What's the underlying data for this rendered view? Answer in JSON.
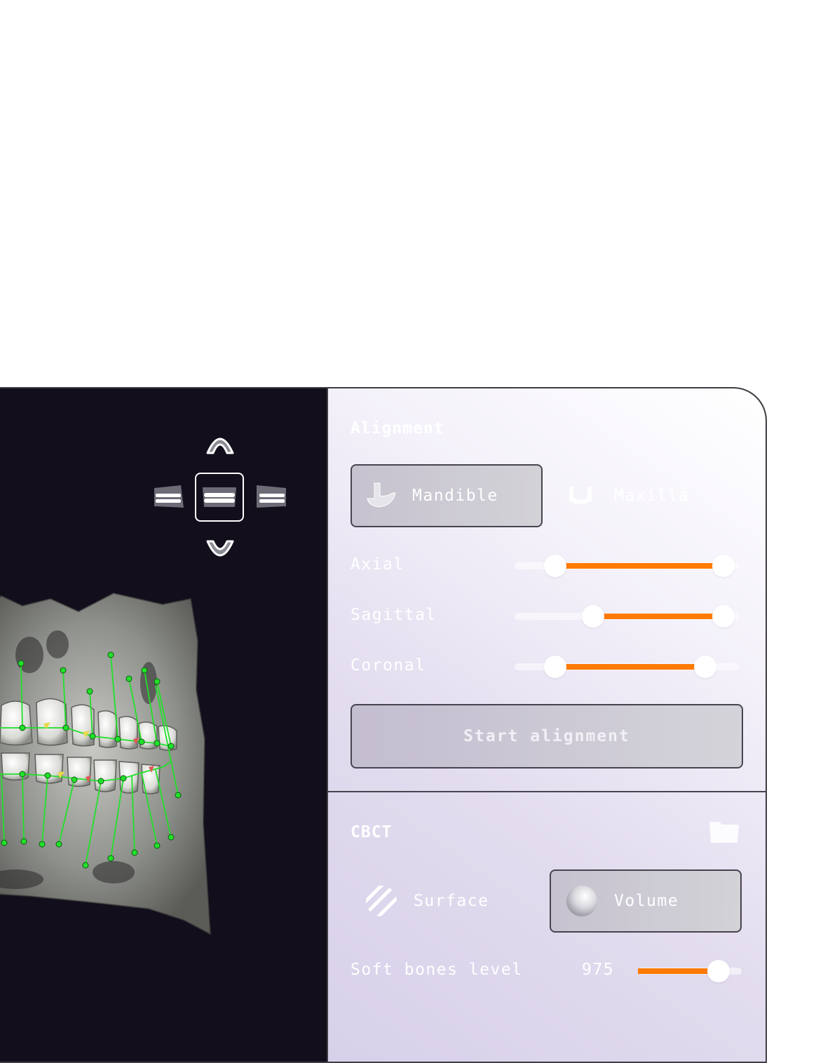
{
  "view_controls": {
    "icons": [
      "upper-jaw-icon",
      "left-view-icon",
      "front-view-icon",
      "right-view-icon",
      "lower-jaw-icon"
    ],
    "active": "front-view-icon"
  },
  "viewport": {
    "image": "3D CBCT jaw render with green landmark points"
  },
  "alignment": {
    "title": "Alignment",
    "jaw_options": [
      {
        "label": "Mandible",
        "icon": "mandible-icon",
        "selected": true
      },
      {
        "label": "Maxilla",
        "icon": "maxilla-icon",
        "selected": false
      }
    ],
    "sliders": [
      {
        "label": "Axial",
        "low": 0.18,
        "high": 0.93
      },
      {
        "label": "Sagittal",
        "low": 0.35,
        "high": 0.93
      },
      {
        "label": "Coronal",
        "low": 0.18,
        "high": 0.85
      }
    ],
    "start_label": "Start alignment"
  },
  "cbct": {
    "title": "CBCT",
    "folder_icon": "folder-icon",
    "modes": [
      {
        "label": "Surface",
        "icon": "hatched-sphere-icon",
        "selected": false
      },
      {
        "label": "Volume",
        "icon": "shaded-sphere-icon",
        "selected": true
      }
    ],
    "soft_bones": {
      "label": "Soft bones level",
      "value": "975",
      "level": 0.78
    }
  },
  "colors": {
    "accent": "#ff7a00",
    "viewport_bg": "#120e1c",
    "landmark": "#22e02a"
  }
}
